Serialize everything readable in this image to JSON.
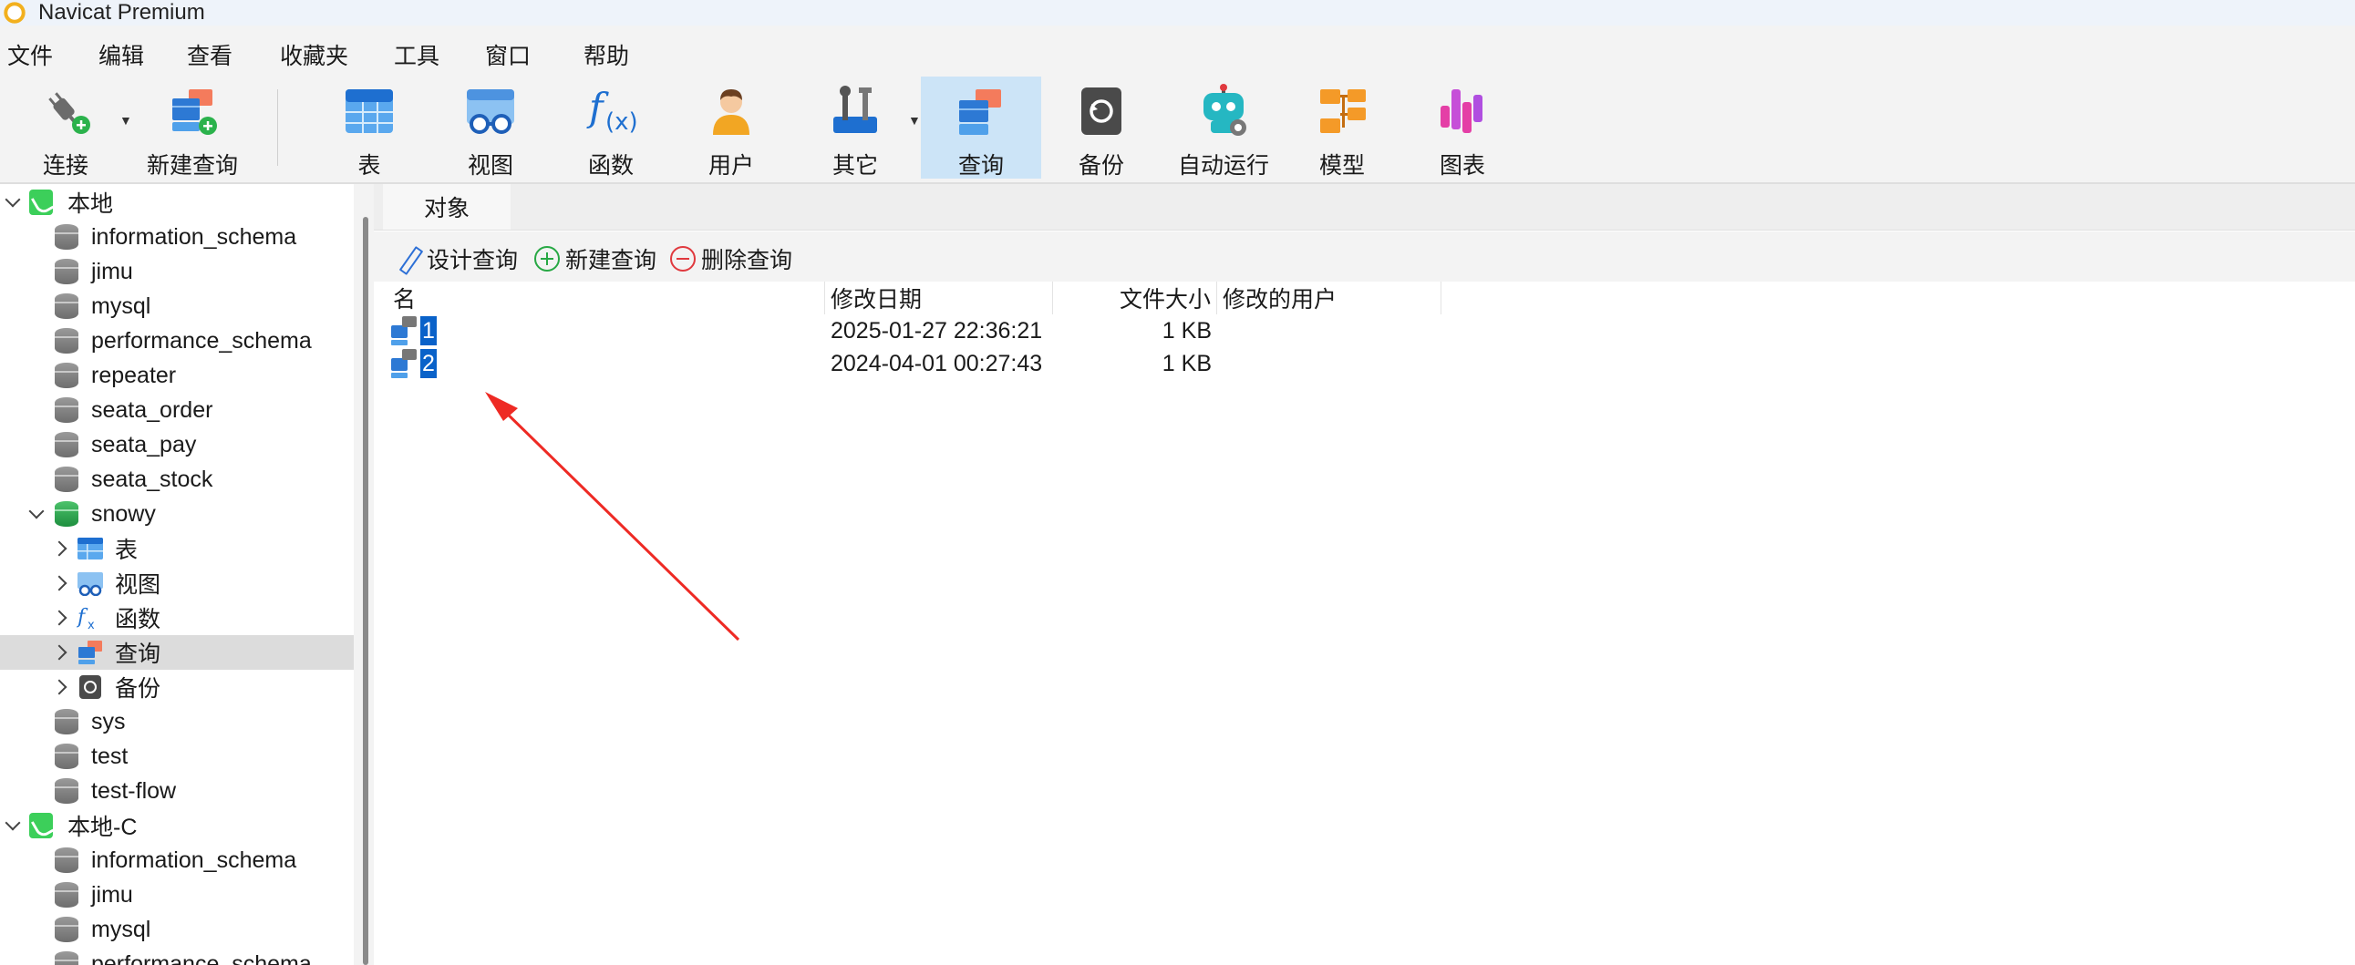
{
  "window": {
    "title": "Navicat Premium"
  },
  "menu": [
    "文件",
    "编辑",
    "查看",
    "收藏夹",
    "工具",
    "窗口",
    "帮助"
  ],
  "toolbar": {
    "connect": "连接",
    "new_query": "新建查询",
    "table": "表",
    "view": "视图",
    "function": "函数",
    "user": "用户",
    "other": "其它",
    "query": "查询",
    "backup": "备份",
    "auto_run": "自动运行",
    "model": "模型",
    "chart": "图表"
  },
  "sidebar": {
    "items": [
      {
        "label": "本地",
        "level": 0,
        "type": "connection",
        "expanded": true
      },
      {
        "label": "information_schema",
        "level": 1,
        "type": "database"
      },
      {
        "label": "jimu",
        "level": 1,
        "type": "database"
      },
      {
        "label": "mysql",
        "level": 1,
        "type": "database"
      },
      {
        "label": "performance_schema",
        "level": 1,
        "type": "database"
      },
      {
        "label": "repeater",
        "level": 1,
        "type": "database"
      },
      {
        "label": "seata_order",
        "level": 1,
        "type": "database"
      },
      {
        "label": "seata_pay",
        "level": 1,
        "type": "database"
      },
      {
        "label": "seata_stock",
        "level": 1,
        "type": "database"
      },
      {
        "label": "snowy",
        "level": 1,
        "type": "database-open",
        "expanded": true
      },
      {
        "label": "表",
        "level": 2,
        "type": "tables"
      },
      {
        "label": "视图",
        "level": 2,
        "type": "views"
      },
      {
        "label": "函数",
        "level": 2,
        "type": "functions"
      },
      {
        "label": "查询",
        "level": 2,
        "type": "queries",
        "selected": true
      },
      {
        "label": "备份",
        "level": 2,
        "type": "backups"
      },
      {
        "label": "sys",
        "level": 1,
        "type": "database"
      },
      {
        "label": "test",
        "level": 1,
        "type": "database"
      },
      {
        "label": "test-flow",
        "level": 1,
        "type": "database"
      },
      {
        "label": "本地-C",
        "level": 0,
        "type": "connection",
        "expanded": true
      },
      {
        "label": "information_schema",
        "level": 1,
        "type": "database"
      },
      {
        "label": "jimu",
        "level": 1,
        "type": "database"
      },
      {
        "label": "mysql",
        "level": 1,
        "type": "database"
      },
      {
        "label": "performance_schema",
        "level": 1,
        "type": "database"
      }
    ]
  },
  "main": {
    "tab": "对象",
    "actions": {
      "design": "设计查询",
      "new": "新建查询",
      "delete": "删除查询"
    },
    "columns": {
      "name": "名",
      "modified": "修改日期",
      "size": "文件大小",
      "user": "修改的用户"
    },
    "rows": [
      {
        "name": "1",
        "modified": "2025-01-27 22:36:21",
        "size": "1 KB",
        "user": ""
      },
      {
        "name": "2",
        "modified": "2024-04-01 00:27:43",
        "size": "1 KB",
        "user": ""
      }
    ]
  },
  "colors": {
    "selection": "#0a62c9",
    "active_tool": "#cce4f7",
    "annotation_arrow": "#ee2a24"
  }
}
